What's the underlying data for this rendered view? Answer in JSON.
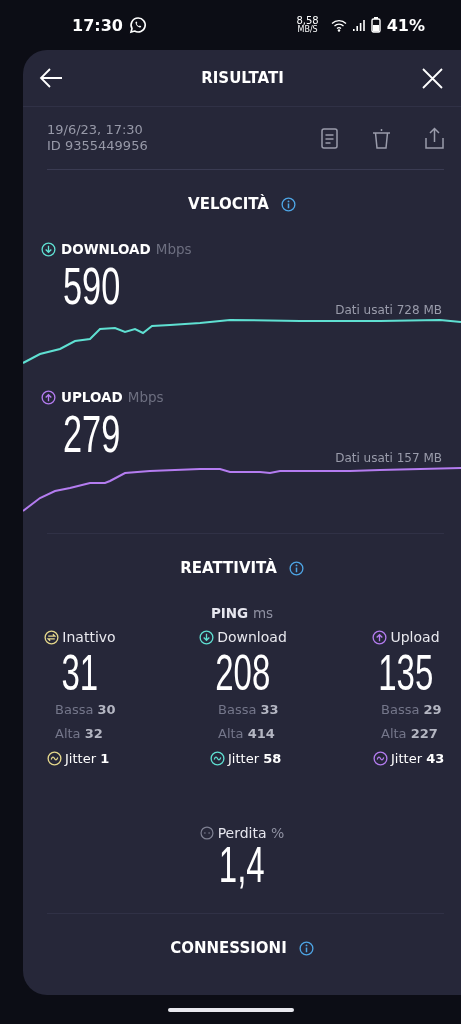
{
  "status_bar": {
    "time": "17:30",
    "net_speed": "8,58",
    "net_speed_unit": "MB/S",
    "battery": "41%"
  },
  "header": {
    "title": "RISULTATI"
  },
  "meta": {
    "date": "19/6/23, 17:30",
    "id": "ID 9355449956"
  },
  "speed": {
    "title": "VELOCITÀ",
    "tests": [
      {
        "kind": "download",
        "label": "DOWNLOAD",
        "unit": "Mbps",
        "value": "590",
        "data_used": "Dati usati 728 MB",
        "color": "#5fe0d2"
      },
      {
        "kind": "upload",
        "label": "UPLOAD",
        "unit": "Mbps",
        "value": "279",
        "data_used": "Dati usati 157 MB",
        "color": "#b47cf0"
      }
    ]
  },
  "responsiveness": {
    "title": "REATTIVITÀ",
    "ping_label": "PING",
    "ping_unit": "ms",
    "columns": [
      {
        "kind": "idle",
        "label": "Inattivo",
        "value": "31",
        "low_label": "Bassa",
        "low": "30",
        "high_label": "Alta",
        "high": "32",
        "jitter_label": "Jitter",
        "jitter": "1",
        "color": "#e6d98c"
      },
      {
        "kind": "download",
        "label": "Download",
        "value": "208",
        "low_label": "Bassa",
        "low": "33",
        "high_label": "Alta",
        "high": "414",
        "jitter_label": "Jitter",
        "jitter": "58",
        "color": "#5fe0d2"
      },
      {
        "kind": "upload",
        "label": "Upload",
        "value": "135",
        "low_label": "Bassa",
        "low": "29",
        "high_label": "Alta",
        "high": "227",
        "jitter_label": "Jitter",
        "jitter": "43",
        "color": "#b47cf0"
      }
    ],
    "loss": {
      "label": "Perdita",
      "unit": "%",
      "value": "1,4"
    }
  },
  "connections": {
    "title": "CONNESSIONI"
  }
}
